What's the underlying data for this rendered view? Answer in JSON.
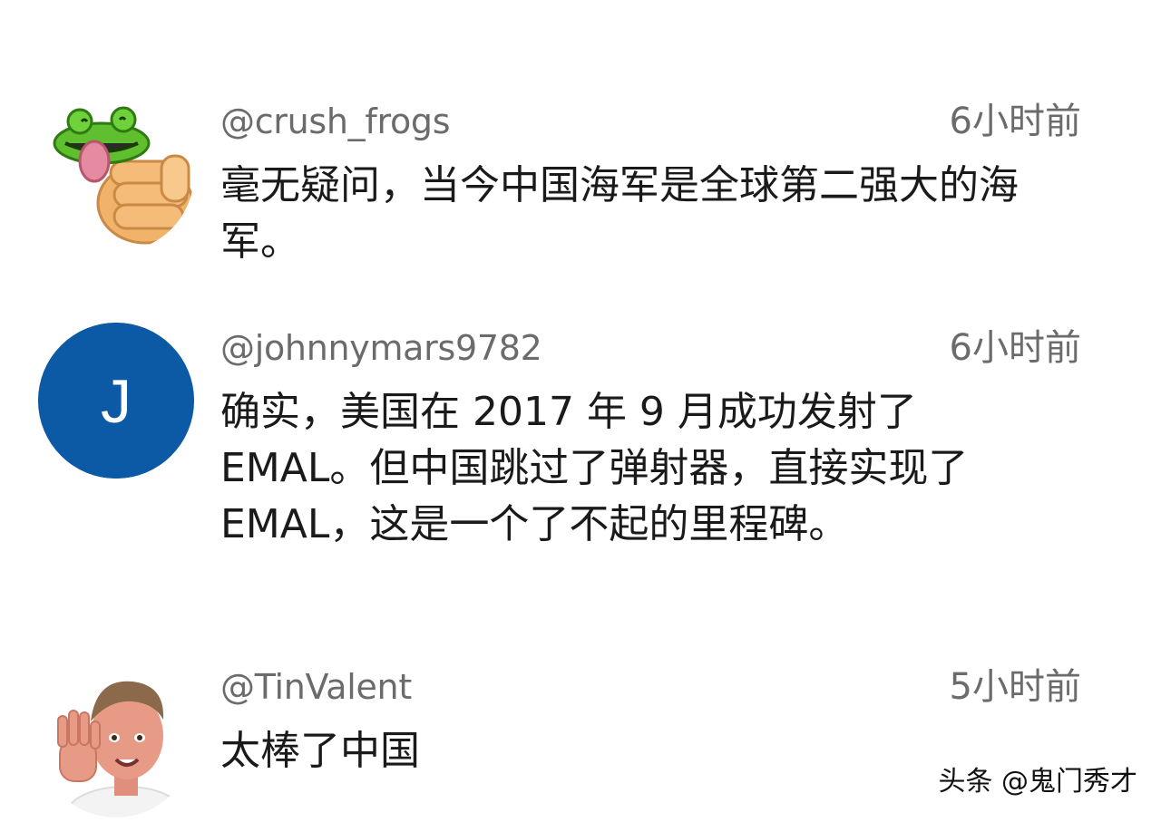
{
  "comments": [
    {
      "username": "@crush_frogs",
      "time": "6小时前",
      "text": "毫无疑问，当今中国海军是全球第二强大的海军。",
      "avatar": {
        "icon": "frog-hand-sticker",
        "colors": {
          "frog": "#5fbf2e",
          "hand": "#f1b36a",
          "tongue": "#e58aa0"
        }
      }
    },
    {
      "username": "@johnnymars9782",
      "time": "6小时前",
      "text": "确实，美国在 2017 年 9 月成功发射了 EMAL。但中国跳过了弹射器，直接实现了 EMAL，这是一个了不起的里程碑。",
      "avatar": {
        "icon": "letter-avatar",
        "letter": "J",
        "colors": {
          "background": "#0c5aa6",
          "letter": "#ffffff"
        }
      }
    },
    {
      "username": "@TinValent",
      "time": "5小时前",
      "text": "太棒了中国",
      "avatar": {
        "icon": "waving-person-avatar",
        "colors": {
          "skin": "#e79a86",
          "hair": "#8a6a4a"
        }
      }
    }
  ],
  "watermark": "头条 @鬼门秀才",
  "colors": {
    "username": "#6b6b6b",
    "time": "#6b6b6b",
    "text": "#1a1a1a",
    "background": "#ffffff"
  }
}
